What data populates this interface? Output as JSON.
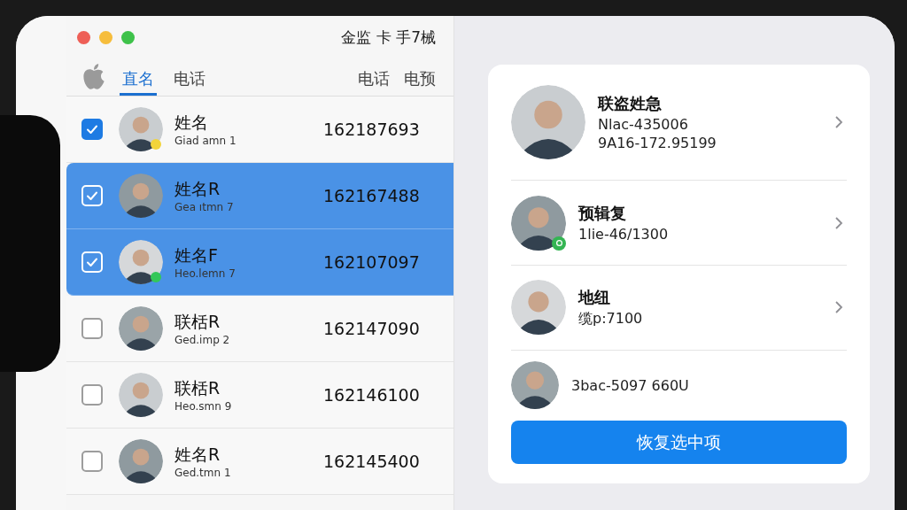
{
  "window": {
    "title": "金监 卡 手7械",
    "controls": [
      {
        "color": "#ee5f57"
      },
      {
        "color": "#f6bd3c"
      },
      {
        "color": "#3ec24a"
      }
    ]
  },
  "tabs": [
    {
      "label": "直名",
      "selected": true
    },
    {
      "label": "电话",
      "selected": false
    }
  ],
  "columns": [
    "电话",
    "电预"
  ],
  "contacts": [
    {
      "name": "姓名",
      "sub": "Giad amn 1",
      "phone": "162187693",
      "checked": true,
      "selected": false,
      "color": "#f2d43a"
    },
    {
      "name": "姓名R",
      "sub": "Gea ıtmn 7",
      "phone": "162167488",
      "checked": true,
      "selected": true
    },
    {
      "name": "姓名F",
      "sub": "Heo.lemn 7",
      "phone": "162107097",
      "checked": true,
      "selected": true,
      "color": "#34c759"
    },
    {
      "name": "联栝R",
      "sub": "Ged.imp 2",
      "phone": "162147090",
      "checked": false,
      "selected": false
    },
    {
      "name": "联栝R",
      "sub": "Heo.smn 9",
      "phone": "162146100",
      "checked": false,
      "selected": false
    },
    {
      "name": "姓名R",
      "sub": "Ged.tmn 1",
      "phone": "162145400",
      "checked": false,
      "selected": false
    }
  ],
  "detail": {
    "items": [
      {
        "name": "联盗姓急",
        "lines": [
          "Nlac-435006",
          "9A16-172.95199"
        ],
        "chevron": true,
        "large": true
      },
      {
        "name": "预辑复",
        "lines": [
          "1lie-46/1300"
        ],
        "chevron": true,
        "badge": true
      },
      {
        "name": "地纽",
        "lines": [
          "缆p:7100"
        ],
        "chevron": true
      },
      {
        "lines": [
          "3bac-5097 660U"
        ],
        "chevron": false
      }
    ],
    "button": "恢复选中项"
  }
}
